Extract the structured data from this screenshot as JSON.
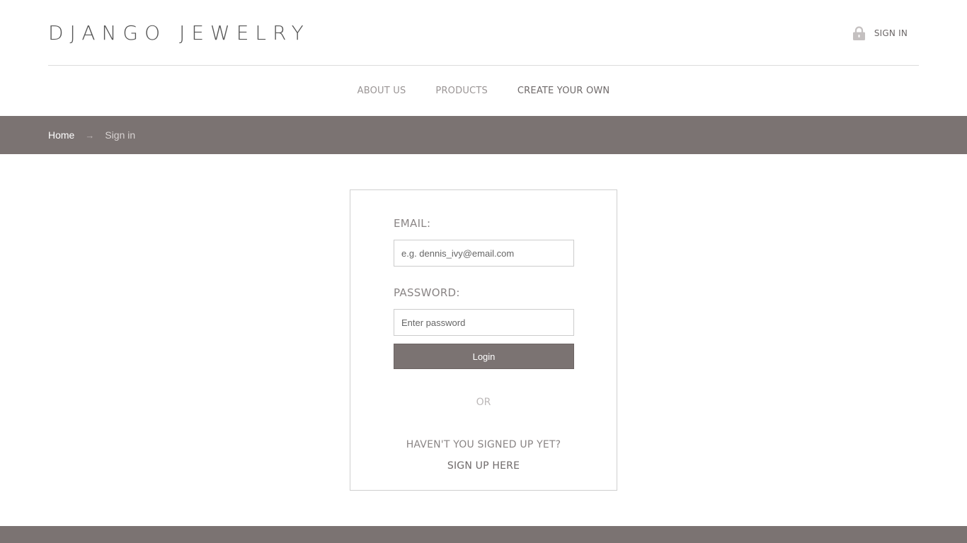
{
  "header": {
    "logo": "DJANGO JEWELRY",
    "signin_label": "SIGN IN"
  },
  "nav": {
    "items": [
      {
        "label": "ABOUT US"
      },
      {
        "label": "PRODUCTS"
      },
      {
        "label": "CREATE YOUR OWN"
      }
    ]
  },
  "breadcrumb": {
    "home": "Home",
    "separator": "→",
    "current": "Sign in"
  },
  "form": {
    "email_label": "EMAIL:",
    "email_placeholder": "e.g. dennis_ivy@email.com",
    "email_value": "",
    "password_label": "PASSWORD:",
    "password_placeholder": "Enter password",
    "password_value": "",
    "login_label": "Login",
    "or_text": "OR",
    "signup_prompt": "HAVEN'T YOU SIGNED UP YET?",
    "signup_link": "SIGN UP HERE"
  },
  "icons": {
    "signin": "lock-icon"
  },
  "colors": {
    "accent": "#7b7372",
    "border": "#cfcfcf",
    "text_muted": "#8a8585"
  }
}
